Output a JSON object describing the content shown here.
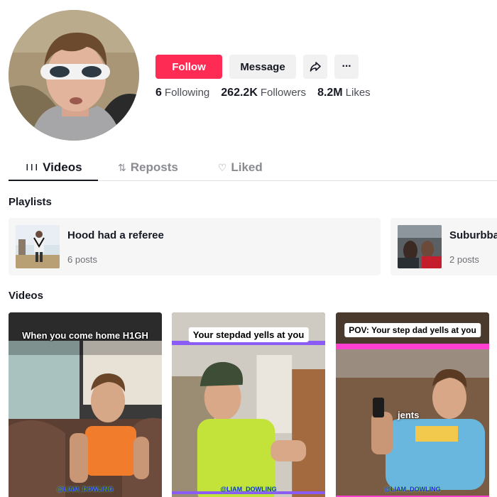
{
  "profile": {
    "avatar_alt": "profile-photo",
    "actions": {
      "follow_label": "Follow",
      "message_label": "Message",
      "share_icon": "share-icon",
      "more_icon": "more-icon",
      "more_label": "···"
    },
    "stats": [
      {
        "value": "6",
        "label": "Following"
      },
      {
        "value": "262.2K",
        "label": "Followers"
      },
      {
        "value": "8.2M",
        "label": "Likes"
      }
    ]
  },
  "tabs": [
    {
      "label": "Videos",
      "icon": "grid-bars-icon",
      "glyph": "❙❙❙",
      "active": true
    },
    {
      "label": "Reposts",
      "icon": "repost-icon",
      "glyph": "⇅",
      "active": false
    },
    {
      "label": "Liked",
      "icon": "heart-icon",
      "glyph": "♡",
      "active": false
    }
  ],
  "playlists": {
    "title": "Playlists",
    "items": [
      {
        "name": "Hood had a referee",
        "count": "6 posts"
      },
      {
        "name": "Suburbbal",
        "count": "2 posts"
      }
    ]
  },
  "videos": {
    "title": "Videos",
    "items": [
      {
        "caption": "When you come home H1GH",
        "watermark": "@LIAM_DOWLING"
      },
      {
        "caption": "Your stepdad yells at you",
        "watermark": "@LIAM_DOWLING"
      },
      {
        "caption": "POV: Your step dad yells at you",
        "overlay": "jents",
        "watermark": "@LIAM_DOWLING"
      }
    ]
  },
  "colors": {
    "accent": "#fe2c55",
    "text": "#161823",
    "muted": "#8a8b91",
    "card_bg": "#f6f6f7"
  }
}
